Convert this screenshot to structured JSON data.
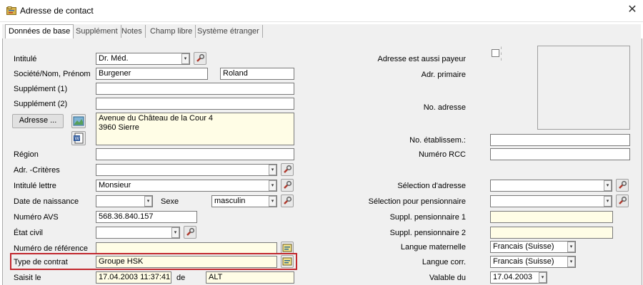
{
  "window": {
    "title": "Adresse de contact",
    "close_icon": "close-icon",
    "app_icon": "address-book-icon"
  },
  "tabs": [
    {
      "label": "Données de base",
      "active": true
    },
    {
      "label": "Supplément",
      "active": false
    },
    {
      "label": "Notes",
      "active": false
    },
    {
      "label": "Champ libre",
      "active": false
    },
    {
      "label": "Système étranger",
      "active": false
    }
  ],
  "left": {
    "intitule": {
      "label": "Intitulé",
      "value": "Dr. Méd."
    },
    "societe": {
      "label": "Société/Nom, Prénom",
      "nom": "Burgener",
      "prenom": "Roland"
    },
    "supplement1": {
      "label": "Supplément (1)",
      "value": ""
    },
    "supplement2": {
      "label": "Supplément (2)",
      "value": ""
    },
    "adresse": {
      "button_label": "Adresse ...",
      "text": "Avenue du Château de la Cour 4\n3960 Sierre"
    },
    "region": {
      "label": "Région",
      "value": ""
    },
    "adr_criteres": {
      "label": "Adr. -Critères",
      "value": ""
    },
    "intitule_lettre": {
      "label": "Intitulé lettre",
      "value": "Monsieur"
    },
    "date_naissance": {
      "label": "Date de naissance",
      "value": ""
    },
    "sexe": {
      "label": "Sexe",
      "value": "masculin"
    },
    "numero_avs": {
      "label": "Numéro  AVS",
      "value": "568.36.840.157"
    },
    "etat_civil": {
      "label": "État civil",
      "value": ""
    },
    "numero_reference": {
      "label": "Numéro de référence",
      "value": ""
    },
    "type_contrat": {
      "label": "Type de contrat",
      "value": "Groupe HSK"
    },
    "saisi_le": {
      "label": "Saisit le",
      "date": "17.04.2003 11:37:41",
      "de_label": "de",
      "user": "ALT"
    }
  },
  "right": {
    "adresse_payeur": {
      "label": "Adresse est aussi payeur",
      "checked": false
    },
    "adr_primaire": {
      "label": "Adr. primaire"
    },
    "no_adresse": {
      "label": "No. adresse"
    },
    "no_etablissement": {
      "label": "No. établissem.:",
      "value": ""
    },
    "numero_rcc": {
      "label": "Numéro RCC",
      "value": ""
    },
    "selection_adresse": {
      "label": "Sélection d'adresse",
      "value": ""
    },
    "selection_pensionnaire": {
      "label": "Sélection pour pensionnaire",
      "value": ""
    },
    "suppl_pens1": {
      "label": "Suppl. pensionnaire 1",
      "value": ""
    },
    "suppl_pens2": {
      "label": "Suppl. pensionnaire 2",
      "value": ""
    },
    "langue_maternelle": {
      "label": "Langue maternelle",
      "value": "Francais (Suisse)"
    },
    "langue_corr": {
      "label": "Langue corr.",
      "value": "Francais (Suisse)"
    },
    "valable_du": {
      "label": "Valable du",
      "value": "17.04.2003"
    }
  },
  "colors": {
    "highlight_frame": "#c1272d",
    "field_yellow": "#fffde6",
    "panel_bg": "#f0f0f0"
  }
}
